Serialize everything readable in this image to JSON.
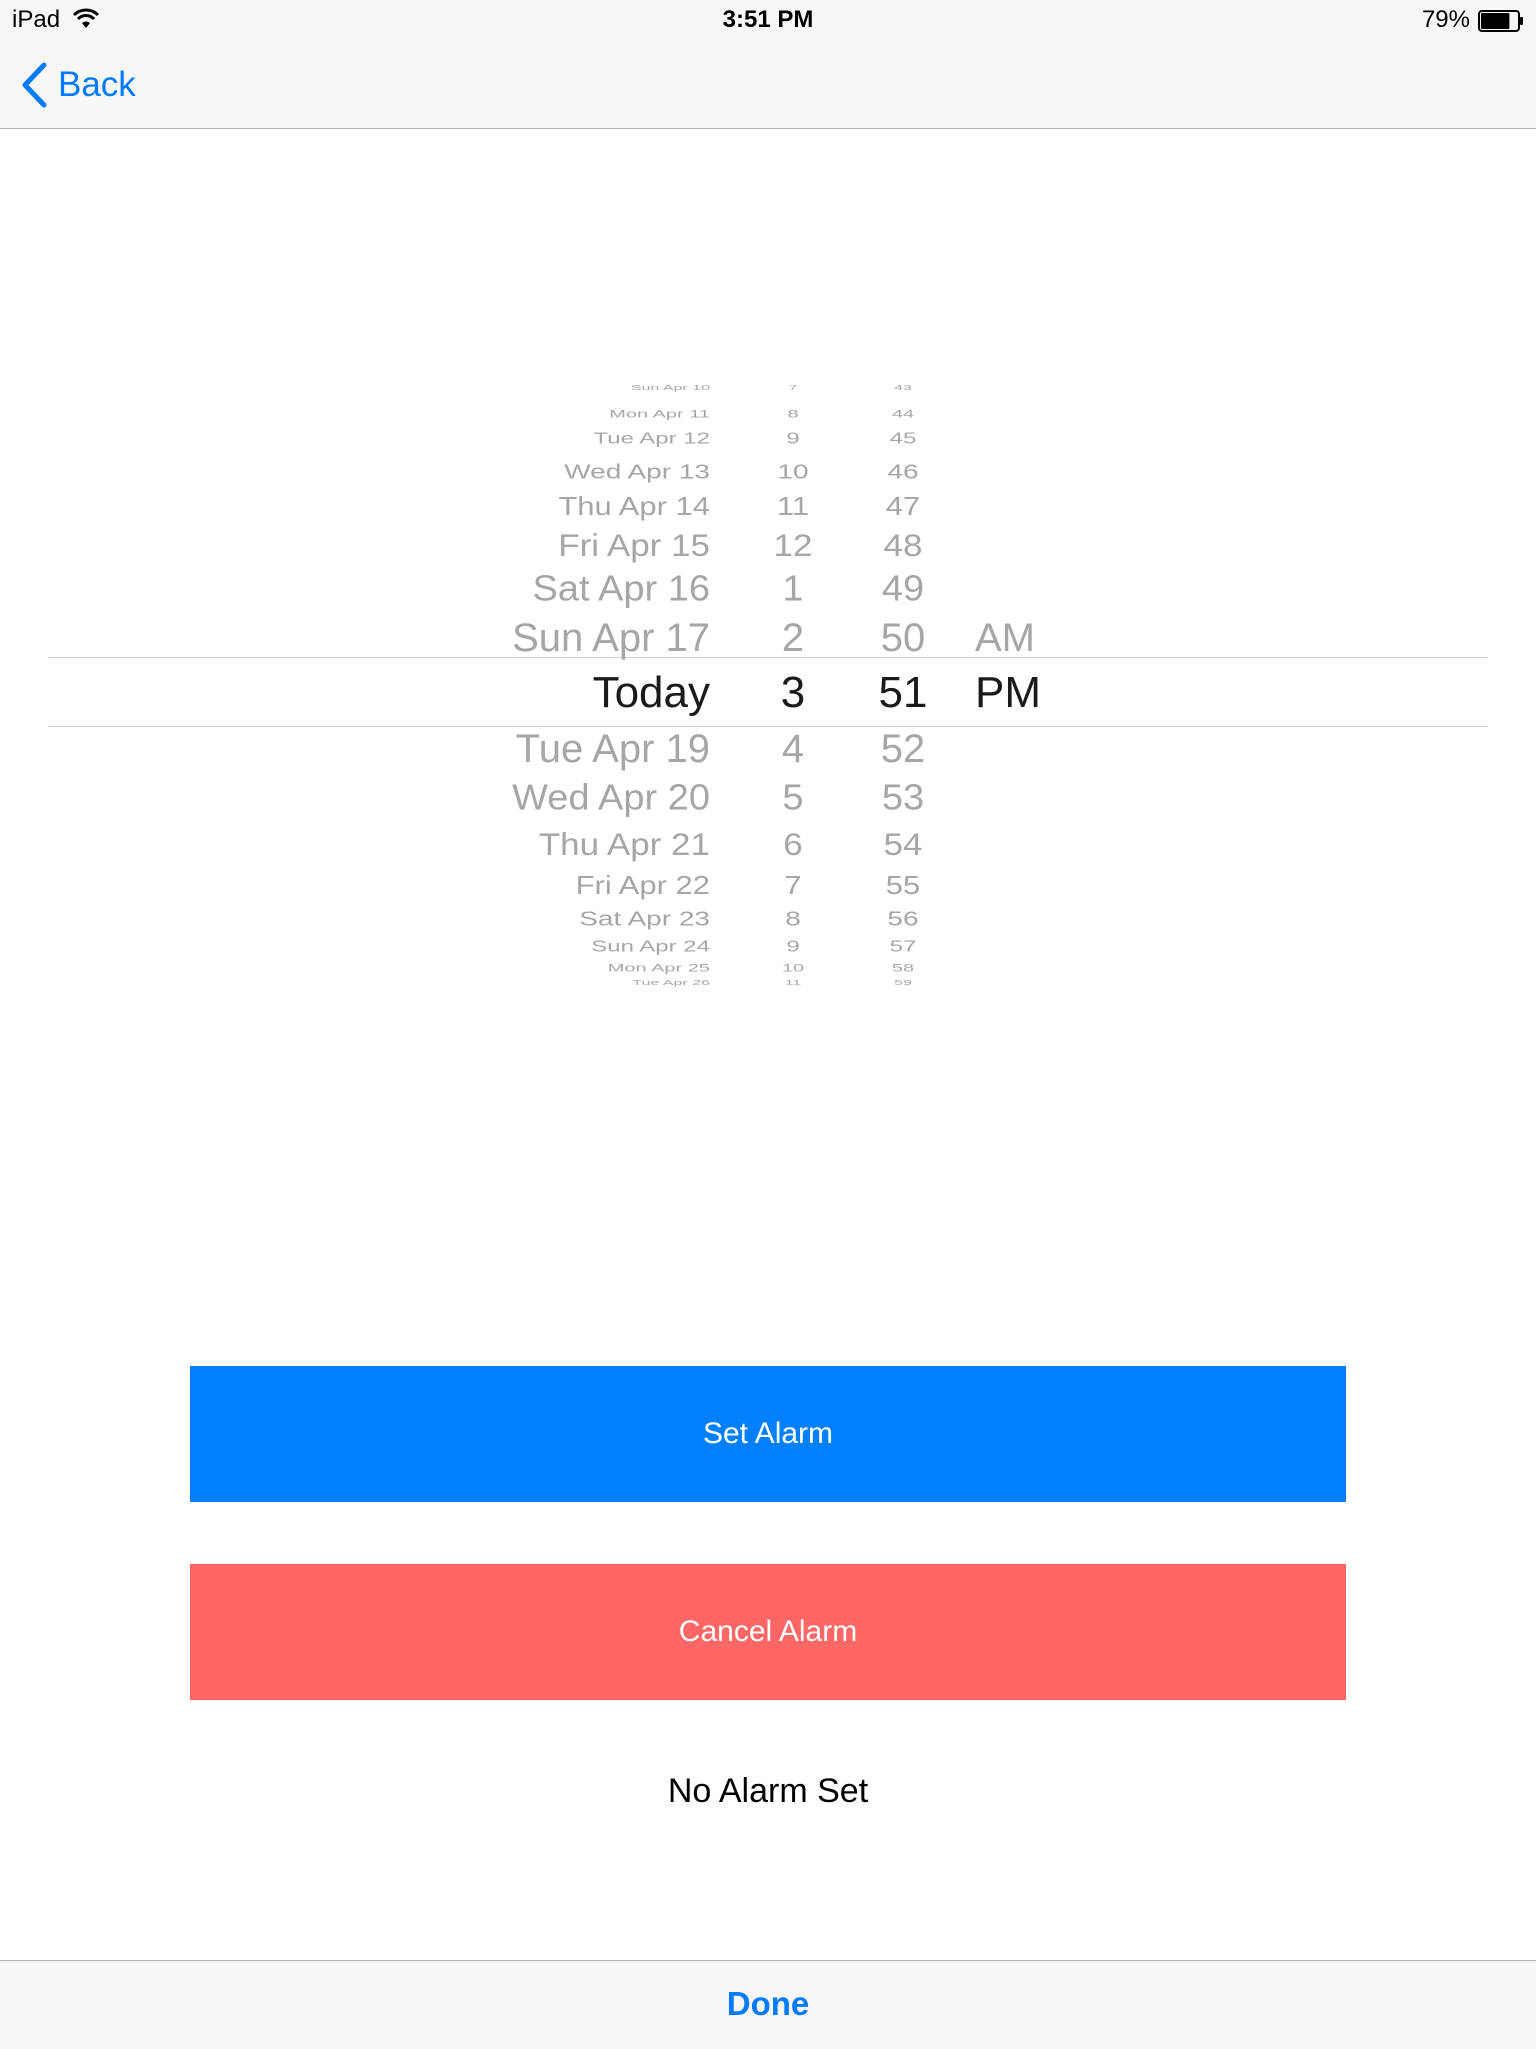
{
  "status_bar": {
    "device": "iPad",
    "time": "3:51 PM",
    "battery": "79%",
    "battery_level": 0.79,
    "wifi_icon": "wifi-icon",
    "battery_icon": "battery-icon"
  },
  "nav": {
    "back_label": "Back",
    "back_icon": "chevron-left-icon"
  },
  "picker": {
    "dates": [
      "Sun Apr 10",
      "Mon Apr 11",
      "Tue Apr 12",
      "Wed Apr 13",
      "Thu Apr 14",
      "Fri Apr 15",
      "Sat Apr 16",
      "Sun Apr 17",
      "Today",
      "Tue Apr 19",
      "Wed Apr 20",
      "Thu Apr 21",
      "Fri Apr 22",
      "Sat Apr 23",
      "Sun Apr 24",
      "Mon Apr 25",
      "Tue Apr 26"
    ],
    "hours": [
      "7",
      "8",
      "9",
      "10",
      "11",
      "12",
      "1",
      "2",
      "3",
      "4",
      "5",
      "6",
      "7",
      "8",
      "9",
      "10",
      "11"
    ],
    "minutes": [
      "43",
      "44",
      "45",
      "46",
      "47",
      "48",
      "49",
      "50",
      "51",
      "52",
      "53",
      "54",
      "55",
      "56",
      "57",
      "58",
      "59"
    ],
    "periods": [
      "",
      "",
      "",
      "",
      "",
      "",
      "",
      "AM",
      "PM",
      "",
      "",
      "",
      "",
      "",
      "",
      "",
      ""
    ],
    "selected_date": "Today",
    "selected_hour": "3",
    "selected_minute": "51",
    "selected_period": "PM"
  },
  "actions": {
    "set_label": "Set Alarm",
    "cancel_label": "Cancel Alarm",
    "set_color": "#0080ff",
    "cancel_color": "#ff6666"
  },
  "status_text": "No Alarm Set",
  "toolbar": {
    "done_label": "Done"
  },
  "colors": {
    "accent": "#007aff"
  }
}
